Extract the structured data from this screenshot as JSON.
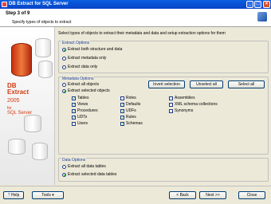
{
  "window": {
    "title": "DB Extract for SQL Server"
  },
  "header": {
    "step": "Step 3 of 9",
    "subtitle": "Specify types of objects to extract"
  },
  "sidebar": {
    "logo_line1": "DB",
    "logo_line2": "Extract",
    "version": "2005",
    "for": "for",
    "product": "SQL Server"
  },
  "intro": "Select types of objects to extract their metadata and data and setup extraction options for them",
  "extract_options": {
    "title": "Extract Options",
    "items": [
      "Extract both structure and data",
      "Extract metadata only",
      "Extract data only"
    ],
    "selected": 0
  },
  "metadata_options": {
    "title": "Metadata Options",
    "radios": [
      "Extract all objects",
      "Extract selected objects"
    ],
    "selected": 1,
    "buttons": {
      "invert": "Invert selection",
      "unselect": "Unselect all",
      "select": "Select all"
    },
    "col1": [
      {
        "label": "Tables",
        "checked": true
      },
      {
        "label": "Views",
        "checked": true
      },
      {
        "label": "Procedures",
        "checked": true
      },
      {
        "label": "UDTs",
        "checked": true
      },
      {
        "label": "Users",
        "checked": false
      }
    ],
    "col2": [
      {
        "label": "Roles",
        "checked": false
      },
      {
        "label": "Defaults",
        "checked": true
      },
      {
        "label": "UDFs",
        "checked": true
      },
      {
        "label": "Rules",
        "checked": true
      },
      {
        "label": "Schemas",
        "checked": true
      }
    ],
    "col3": [
      {
        "label": "Assemblies",
        "checked": false
      },
      {
        "label": "XML schema collections",
        "checked": false
      },
      {
        "label": "Synonyms",
        "checked": false
      }
    ]
  },
  "data_options": {
    "title": "Data Options",
    "items": [
      "Extract all data tables",
      "Extract selected data tables"
    ],
    "selected": 1
  },
  "footer": {
    "help": "Help",
    "tools": "Tools",
    "back": "< Back",
    "next": "Next >>",
    "close": "Close"
  }
}
